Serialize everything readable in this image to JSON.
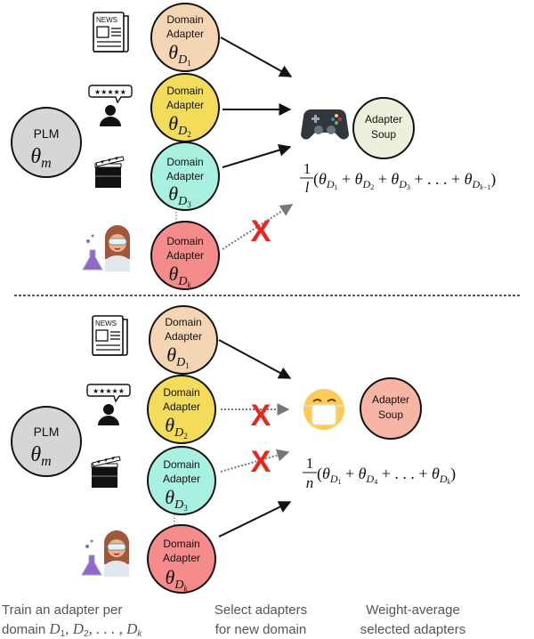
{
  "colors": {
    "plm": "#d6d6d6",
    "adapter_d1": "#f6d5b5",
    "adapter_d2": "#f2dc5a",
    "adapter_d3": "#a8f0df",
    "adapter_dk": "#f58b8b",
    "soup_top": "#ecf0dc",
    "soup_bottom": "#f7b5a6",
    "cross": "#e8261c",
    "arrow": "#111111",
    "dotted_arrow": "#777777"
  },
  "plm": {
    "label": "PLM",
    "param": "θ",
    "param_sub": "m"
  },
  "adapter_label_line1": "Domain",
  "adapter_label_line2": "Adapter",
  "adapters": [
    {
      "domain": "news",
      "icon": "newspaper-icon",
      "param": "θ",
      "sub": "D",
      "subsub": "1"
    },
    {
      "domain": "reviews",
      "icon": "review-person-icon",
      "param": "θ",
      "sub": "D",
      "subsub": "2"
    },
    {
      "domain": "movies",
      "icon": "clapperboard-icon",
      "param": "θ",
      "sub": "D",
      "subsub": "3"
    },
    {
      "domain": "science",
      "icon": "scientist-icon",
      "param": "θ",
      "sub": "D",
      "subsub": "k"
    }
  ],
  "top_panel": {
    "target_icon": "game-controller-icon",
    "soup_line1": "Adapter",
    "soup_line2": "Soup",
    "formula_num": "1",
    "formula_den": "l",
    "formula_terms": [
      "θ_D1",
      "θ_D2",
      "θ_D3",
      "…",
      "θ_Dk-1"
    ],
    "selected": [
      true,
      true,
      true,
      false
    ]
  },
  "bottom_panel": {
    "target_icon": "face-with-mask-icon",
    "soup_line1": "Adapter",
    "soup_line2": "Soup",
    "formula_num": "1",
    "formula_den": "n",
    "formula_terms": [
      "θ_D1",
      "θ_D4",
      "…",
      "θ_Dk"
    ],
    "selected": [
      true,
      false,
      false,
      true
    ]
  },
  "captions": {
    "step1_line1": "Train an adapter per",
    "step1_line2_prefix": "domain",
    "step1_math": "D1, D2, . . . , Dk",
    "step2_line1": "Select adapters",
    "step2_line2": "for new domain",
    "step3_line1": "Weight-average",
    "step3_line2": "selected adapters"
  }
}
